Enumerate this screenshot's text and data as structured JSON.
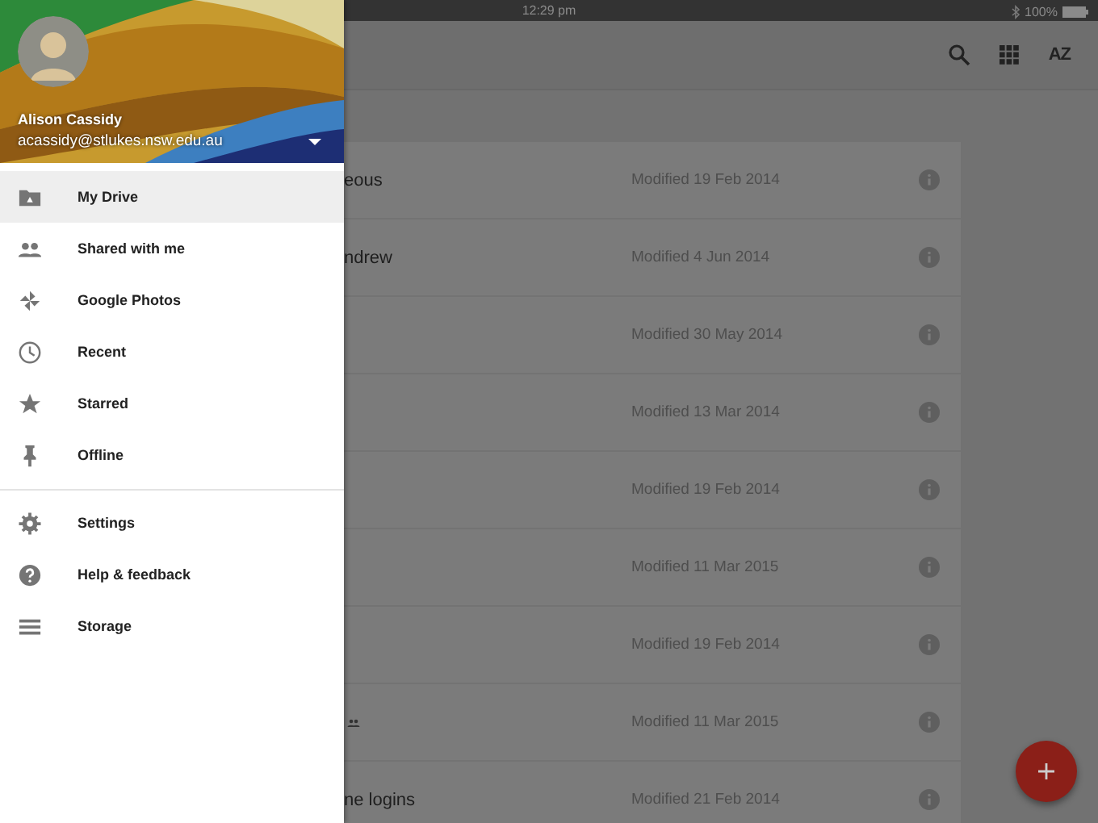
{
  "status_bar": {
    "time": "12:29 pm",
    "battery": "100%"
  },
  "toolbar": {
    "sort_label": "AZ"
  },
  "drawer": {
    "account": {
      "name": "Alison Cassidy",
      "email": "acassidy@stlukes.nsw.edu.au"
    },
    "items": [
      {
        "label": "My Drive",
        "selected": true
      },
      {
        "label": "Shared with me",
        "selected": false
      },
      {
        "label": "Google Photos",
        "selected": false
      },
      {
        "label": "Recent",
        "selected": false
      },
      {
        "label": "Starred",
        "selected": false
      },
      {
        "label": "Offline",
        "selected": false
      }
    ],
    "footer_items": [
      {
        "label": "Settings"
      },
      {
        "label": "Help & feedback"
      },
      {
        "label": "Storage"
      }
    ]
  },
  "files": [
    {
      "name": "eous",
      "modified": "Modified 19 Feb 2014"
    },
    {
      "name": "ndrew",
      "modified": "Modified 4 Jun 2014"
    },
    {
      "modified": "Modified 30 May 2014"
    },
    {
      "modified": "Modified 13 Mar 2014"
    },
    {
      "modified": "Modified 19 Feb 2014"
    },
    {
      "modified": "Modified 11 Mar 2015"
    },
    {
      "modified": "Modified 19 Feb 2014"
    },
    {
      "modified": "Modified 11 Mar 2015",
      "shared": true
    },
    {
      "name": "ne logins",
      "modified": "Modified 21 Feb 2014"
    }
  ]
}
